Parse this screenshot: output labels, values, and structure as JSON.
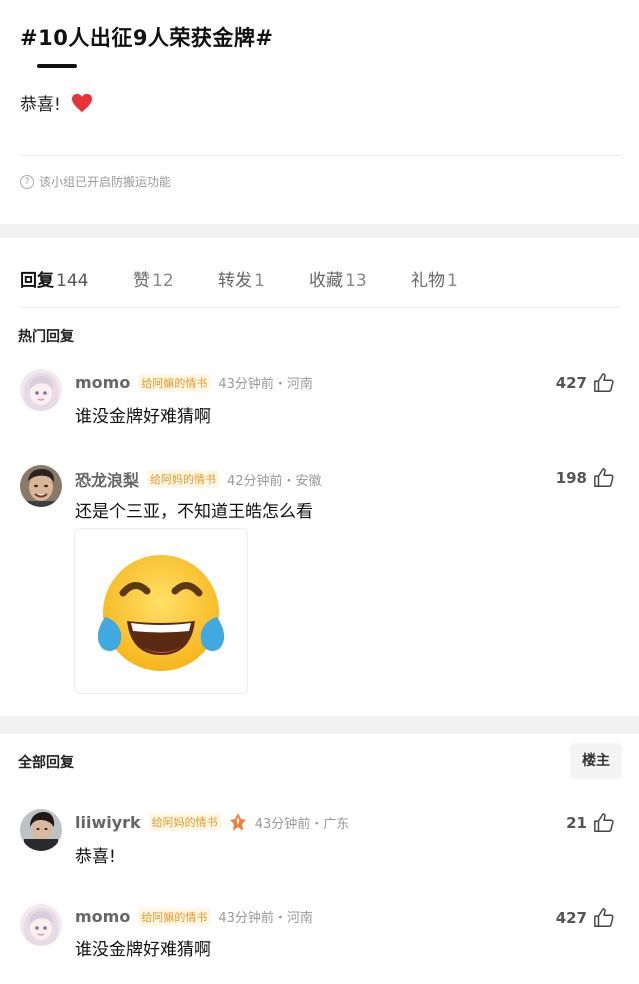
{
  "post": {
    "title": "#10人出征9人荣获金牌#",
    "body": "恭喜!",
    "notice": "该小组已开启防搬运功能"
  },
  "tabs": [
    {
      "label": "回复",
      "count": "144",
      "active": true
    },
    {
      "label": "赞",
      "count": "12",
      "active": false
    },
    {
      "label": "转发",
      "count": "1",
      "active": false
    },
    {
      "label": "收藏",
      "count": "13",
      "active": false
    },
    {
      "label": "礼物",
      "count": "1",
      "active": false
    }
  ],
  "hot_section": {
    "label": "热门回复",
    "comments": [
      {
        "username": "momo",
        "badge": "给阿嫲的情书",
        "meta": "43分钟前・河南",
        "text": "谁没金牌好难猜啊",
        "likes": "427"
      },
      {
        "username": "恐龙浪梨",
        "badge": "给阿妈的情书",
        "meta": "42分钟前・安徽",
        "text": "还是个三亚，不知道王皓怎么看",
        "likes": "198"
      }
    ]
  },
  "all_section": {
    "label": "全部回复",
    "op_button": "楼主",
    "comments": [
      {
        "username": "liiwiyrk",
        "badge": "给阿妈的情书",
        "meta": "43分钟前・广东",
        "text": "恭喜!",
        "likes": "21"
      },
      {
        "username": "momo",
        "badge": "给阿嫲的情书",
        "meta": "43分钟前・河南",
        "text": "谁没金牌好难猜啊",
        "likes": "427"
      }
    ]
  },
  "colors": {
    "badge_text": "#e39a2a",
    "heart": "#e8323a",
    "section_gap": "#f2f2f2"
  }
}
